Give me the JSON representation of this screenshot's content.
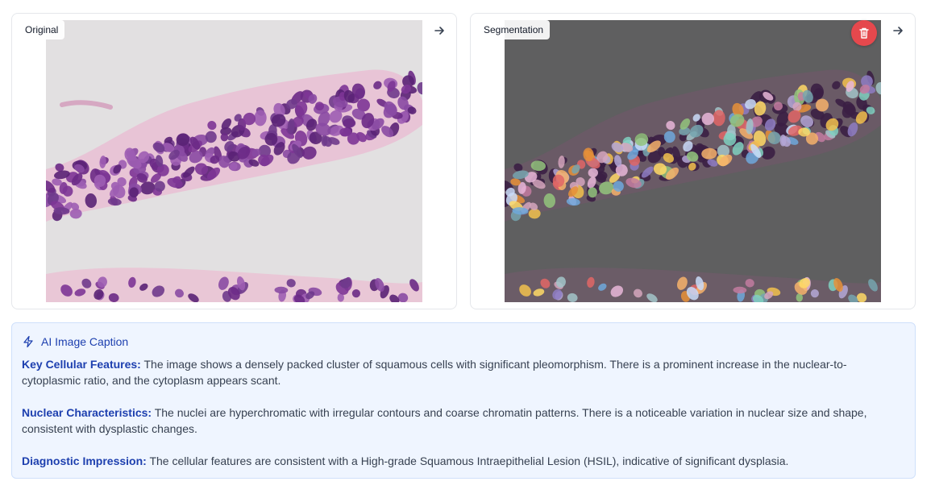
{
  "panels": {
    "original": {
      "label": "Original"
    },
    "segmentation": {
      "label": "Segmentation"
    }
  },
  "icons": {
    "arrow": "arrow-right-icon",
    "delete": "trash-icon",
    "caption": "lightning-icon"
  },
  "colors": {
    "accent": "#1e40af",
    "delete": "#e5484d",
    "caption_bg": "#eff5ff"
  },
  "caption": {
    "title": "AI Image Caption",
    "sections": [
      {
        "heading": "Key Cellular Features:",
        "text": "The image shows a densely packed cluster of squamous cells with significant pleomorphism. There is a prominent increase in the nuclear-to-cytoplasmic ratio, and the cytoplasm appears scant."
      },
      {
        "heading": "Nuclear Characteristics:",
        "text": "The nuclei are hyperchromatic with irregular contours and coarse chromatin patterns. There is a noticeable variation in nuclear size and shape, consistent with dysplastic changes."
      },
      {
        "heading": "Diagnostic Impression:",
        "text": "The cellular features are consistent with a High-grade Squamous Intraepithelial Lesion (HSIL), indicative of significant dysplasia."
      }
    ]
  }
}
